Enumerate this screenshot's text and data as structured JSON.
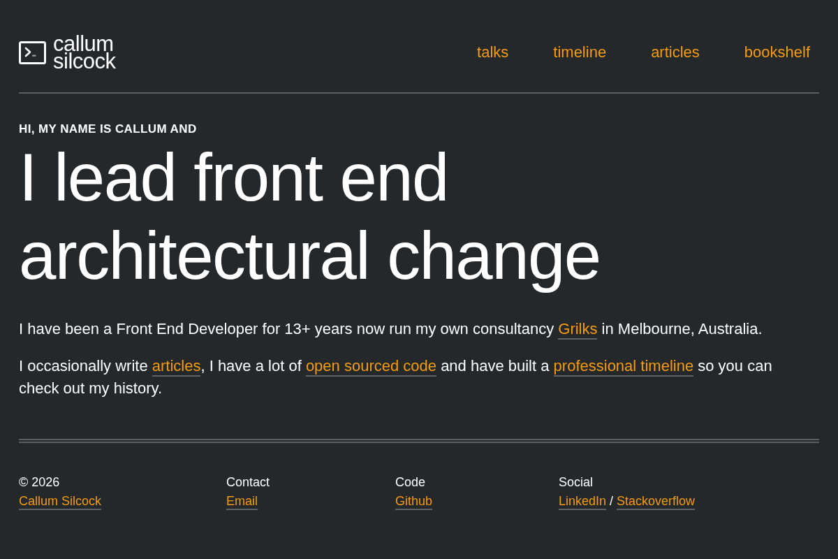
{
  "header": {
    "logo_lines": [
      "callum",
      "silcock"
    ],
    "nav": [
      "talks",
      "timeline",
      "articles",
      "bookshelf"
    ]
  },
  "hero": {
    "eyebrow": "HI, MY NAME IS CALLUM AND",
    "headline_lines": [
      "I lead front end",
      "architectural change"
    ],
    "paragraphs": [
      [
        {
          "kind": "text",
          "text": "I have been a Front End Developer for 13+ years now run my own consultancy "
        },
        {
          "kind": "link",
          "text": "Grilks"
        },
        {
          "kind": "text",
          "text": " in Melbourne, Australia."
        }
      ],
      [
        {
          "kind": "text",
          "text": "I occasionally write "
        },
        {
          "kind": "link",
          "text": "articles"
        },
        {
          "kind": "text",
          "text": ", I have a lot of "
        },
        {
          "kind": "link",
          "text": "open sourced code"
        },
        {
          "kind": "text",
          "text": " and have built a "
        },
        {
          "kind": "link",
          "text": "professional timeline"
        },
        {
          "kind": "text",
          "text": " so you can check out my history."
        }
      ]
    ]
  },
  "footer": {
    "columns": [
      {
        "heading": "© 2026",
        "items": [
          {
            "kind": "link",
            "text": "Callum Silcock"
          }
        ]
      },
      {
        "heading": "Contact",
        "items": [
          {
            "kind": "link",
            "text": "Email"
          }
        ]
      },
      {
        "heading": "Code",
        "items": [
          {
            "kind": "link",
            "text": "Github"
          }
        ]
      },
      {
        "heading": "Social",
        "items": [
          {
            "kind": "link",
            "text": "LinkedIn"
          },
          {
            "kind": "text",
            "text": "/"
          },
          {
            "kind": "link",
            "text": "Stackoverflow"
          }
        ]
      }
    ]
  }
}
